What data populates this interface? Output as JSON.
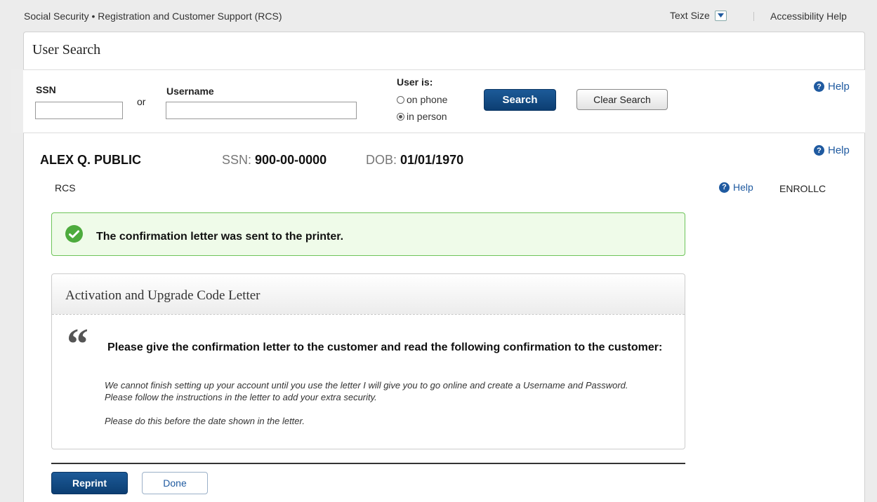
{
  "topbar": {
    "brand": "Social Security • Registration and Customer Support (RCS)",
    "text_size": "Text Size",
    "accessibility": "Accessibility Help"
  },
  "panel": {
    "title": "User Search"
  },
  "search": {
    "ssn_label": "SSN",
    "or": "or",
    "username_label": "Username",
    "ssn_value": "",
    "username_value": "",
    "user_is_label": "User is:",
    "options": [
      "on phone",
      "in person"
    ],
    "selected_option": "in person",
    "search_button": "Search",
    "clear_button": "Clear Search",
    "help": "Help"
  },
  "person": {
    "name": "ALEX Q. PUBLIC",
    "ssn_label": "SSN:",
    "ssn": "900-00-0000",
    "dob_label": "DOB:",
    "dob": "01/01/1970",
    "help": "Help"
  },
  "section": {
    "app": "RCS",
    "help": "Help",
    "code": "ENROLLC"
  },
  "alert": {
    "message": "The confirmation letter was sent to the printer."
  },
  "card": {
    "title": "Activation and Upgrade Code Letter",
    "quote_mark": "“",
    "heading": "Please give the confirmation letter to the customer and read the following confirmation to the customer:",
    "para1": "We cannot finish setting up your account until you use the letter I will give you to go online and create a Username and Password. Please follow the instructions in the letter to add your extra security.",
    "para2": "Please do this before the date shown in the letter."
  },
  "actions": {
    "reprint": "Reprint",
    "done": "Done"
  },
  "colors": {
    "primary": "#0c3e72",
    "link": "#1f5aa0",
    "success": "#4dab3d"
  }
}
